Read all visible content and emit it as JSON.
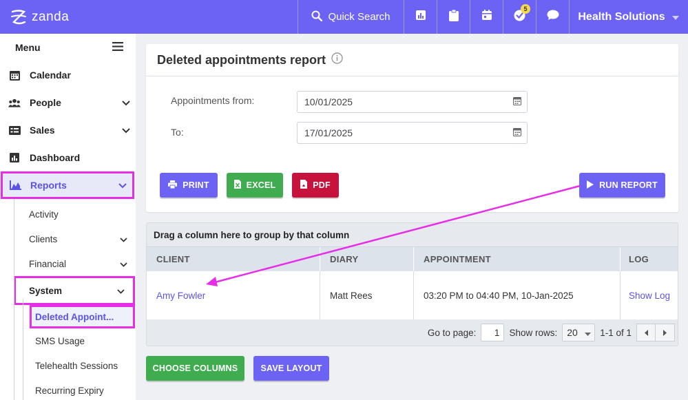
{
  "brand": {
    "name": "zanda"
  },
  "topbar": {
    "search_label": "Quick Search",
    "icons": [
      "chart-icon",
      "clipboard-icon",
      "calendar-icon",
      "tasks-icon",
      "chat-icon"
    ],
    "tasks_badge": "5",
    "org_name": "Health Solutions"
  },
  "sidebar": {
    "menu_label": "Menu",
    "items": [
      {
        "label": "Calendar",
        "icon": "calendar-icon"
      },
      {
        "label": "People",
        "icon": "people-icon"
      },
      {
        "label": "Sales",
        "icon": "sales-icon"
      },
      {
        "label": "Dashboard",
        "icon": "dashboard-icon"
      },
      {
        "label": "Reports",
        "icon": "area-chart-icon"
      }
    ],
    "report_sub": [
      "Activity",
      "Clients",
      "Financial",
      "System"
    ],
    "system_sub": [
      "Deleted Appoint...",
      "SMS Usage",
      "Telehealth Sessions",
      "Recurring Expiry"
    ]
  },
  "report": {
    "title": "Deleted appointments report",
    "from_label": "Appointments from:",
    "from_value": "10/01/2025",
    "to_label": "To:",
    "to_value": "17/01/2025",
    "print_label": "PRINT",
    "excel_label": "EXCEL",
    "pdf_label": "PDF",
    "run_label": "RUN REPORT"
  },
  "grid": {
    "group_hint": "Drag a column here to group by that column",
    "columns": [
      "CLIENT",
      "DIARY",
      "APPOINTMENT",
      "LOG"
    ],
    "rows": [
      {
        "client": "Amy Fowler",
        "diary": "Matt Rees",
        "appointment": "03:20 PM to 04:40 PM, 10-Jan-2025",
        "log": "Show Log"
      }
    ],
    "pager": {
      "goto_label": "Go to page:",
      "page": "1",
      "rows_label": "Show rows:",
      "rows_value": "20",
      "range": "1-1 of 1"
    }
  },
  "footer": {
    "choose_label": "CHOOSE COLUMNS",
    "save_label": "SAVE LAYOUT"
  },
  "colors": {
    "primary": "#6c63f5",
    "success": "#3fad4f",
    "danger": "#c8123e",
    "highlight": "#e52ee5"
  }
}
